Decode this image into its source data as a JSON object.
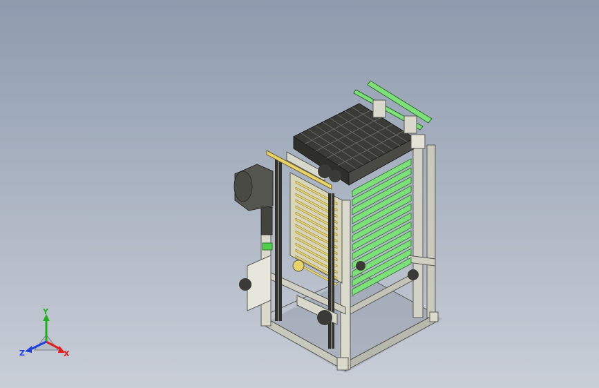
{
  "viewport": {
    "background_top": "#8e9bae",
    "background_bottom": "#c9ced7"
  },
  "model": {
    "frame_color": "#d9d9cc",
    "accent_green": "#7ee07a",
    "accent_yellow": "#e8d36a",
    "dark_part": "#3a3a36",
    "chain_color": "#2f2f2c",
    "motor_color": "#55554f"
  },
  "triad": {
    "x_label": "X",
    "y_label": "Y",
    "z_label": "Z",
    "x_color": "#e02020",
    "y_color": "#20b020",
    "z_color": "#2040e0"
  }
}
